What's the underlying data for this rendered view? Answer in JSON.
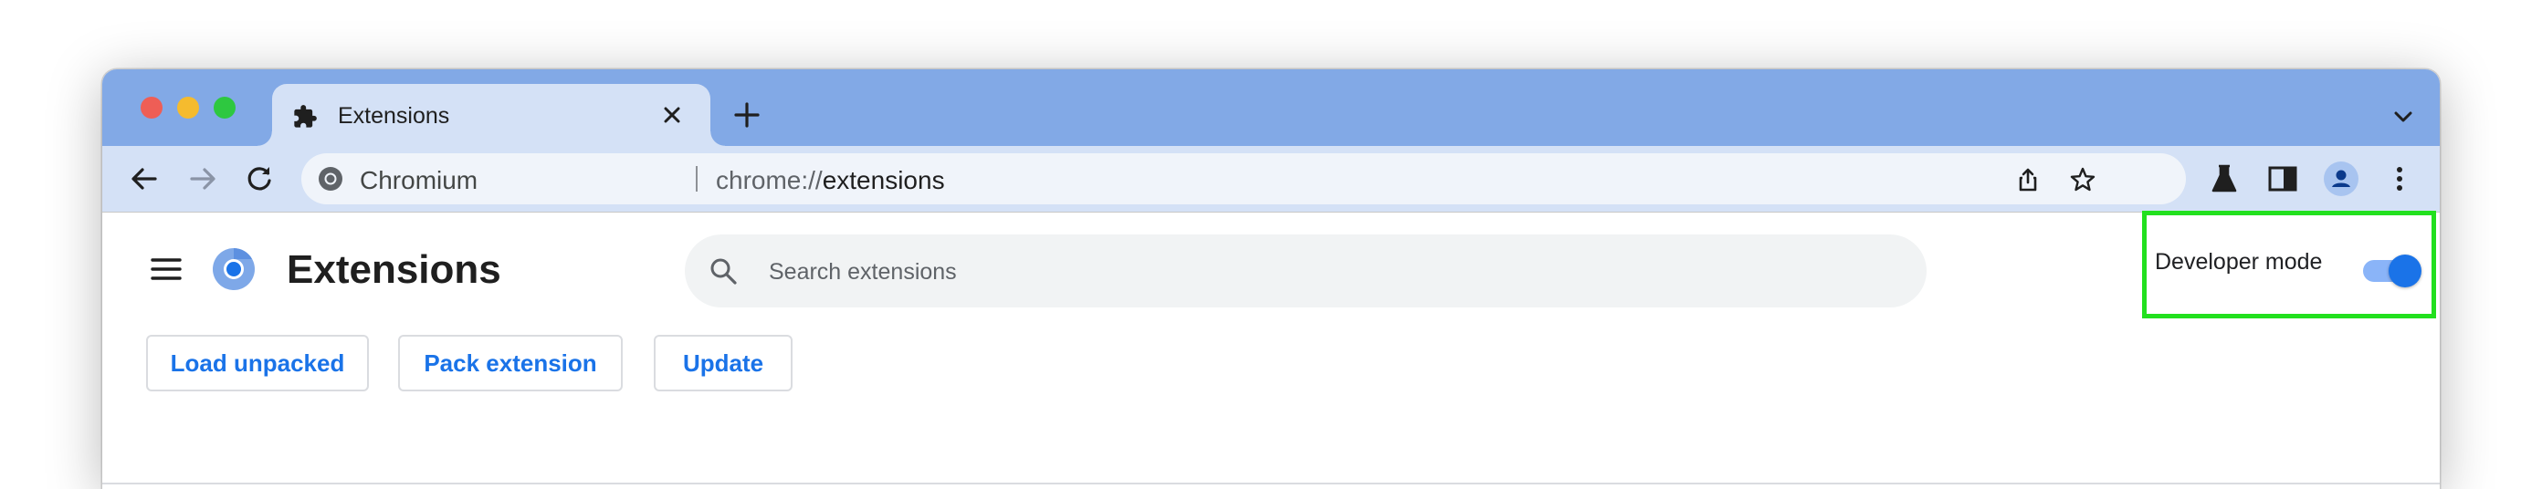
{
  "tab": {
    "title": "Extensions"
  },
  "omnibox": {
    "site_name": "Chromium",
    "url_scheme": "chrome://",
    "url_host": "extensions"
  },
  "page": {
    "title": "Extensions",
    "search_placeholder": "Search extensions",
    "developer_mode_label": "Developer mode",
    "developer_mode_enabled": true,
    "buttons": [
      "Load unpacked",
      "Pack extension",
      "Update"
    ]
  },
  "icons": {
    "tab": "puzzle-icon",
    "toolbar": [
      "back-arrow-icon",
      "forward-arrow-icon",
      "reload-icon"
    ],
    "omnibox": [
      "share-icon",
      "star-icon"
    ],
    "toolbar_right": [
      "flask-icon",
      "side-panel-icon",
      "profile-avatar-icon",
      "more-vert-icon"
    ]
  },
  "colors": {
    "tabstrip": "#82a9e6",
    "toolbar": "#d4e1f6",
    "accent": "#1a73e8",
    "highlight": "#22e01e"
  }
}
